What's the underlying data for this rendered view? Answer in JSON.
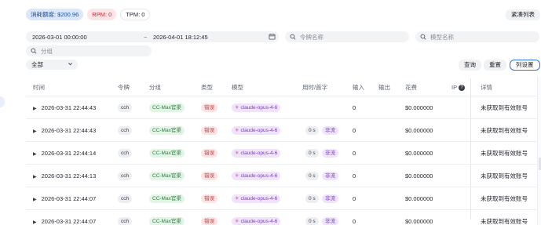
{
  "stats": {
    "quota": "消耗额度: $200.96",
    "rpm": "RPM: 0",
    "tpm": "TPM: 0"
  },
  "toolbar": {
    "compact_label": "紧凑列表",
    "query_label": "查询",
    "reset_label": "重置",
    "columns_label": "列设置"
  },
  "filters": {
    "date_start": "2026-03-01 00:00:00",
    "date_separator": "~",
    "date_end": "2026-04-01 18:12:45",
    "token_placeholder": "令牌名称",
    "model_placeholder": "模型名称",
    "group_placeholder": "分组",
    "type_select": "全部"
  },
  "icons": {
    "search": "search-icon",
    "calendar": "calendar-icon",
    "chevron": "chevron-down-icon",
    "expand": "expand-arrow-icon",
    "help": "help-circle-icon"
  },
  "colors": {
    "accent": "#2f6fe0",
    "quota_bg": "#dbe8fb",
    "rpm_bg": "#fde4e6",
    "group_badge": "#e2f5e7",
    "error_badge": "#fde3e3",
    "model_badge": "#f0e4fb"
  },
  "table": {
    "headers": [
      "时间",
      "令牌",
      "分组",
      "类型",
      "模型",
      "用时/首字",
      "输入",
      "输出",
      "花费",
      "IP",
      "详情"
    ],
    "rows": [
      {
        "time": "2026-03-31 22:44:43",
        "token": "cch",
        "group": "CC-Max官渠",
        "type": "错误",
        "model": "claude-opus-4-6",
        "duration": "",
        "stream": "",
        "input": "0",
        "output": "",
        "cost": "$0.000000",
        "ip": "",
        "detail": "未获取到有效账号"
      },
      {
        "time": "2026-03-31 22:44:43",
        "token": "cch",
        "group": "CC-Max官渠",
        "type": "错误",
        "model": "claude-opus-4-6",
        "duration": "0 s",
        "stream": "非流",
        "input": "0",
        "output": "",
        "cost": "$0.000000",
        "ip": "",
        "detail": "未获取到有效账号"
      },
      {
        "time": "2026-03-31 22:44:14",
        "token": "cch",
        "group": "CC-Max官渠",
        "type": "错误",
        "model": "claude-opus-4-6",
        "duration": "0 s",
        "stream": "非流",
        "input": "0",
        "output": "",
        "cost": "$0.000000",
        "ip": "",
        "detail": "未获取到有效账号"
      },
      {
        "time": "2026-03-31 22:44:13",
        "token": "cch",
        "group": "CC-Max官渠",
        "type": "错误",
        "model": "claude-opus-4-6",
        "duration": "0 s",
        "stream": "非流",
        "input": "0",
        "output": "",
        "cost": "$0.000000",
        "ip": "",
        "detail": "未获取到有效账号"
      },
      {
        "time": "2026-03-31 22:44:07",
        "token": "cch",
        "group": "CC-Max官渠",
        "type": "错误",
        "model": "claude-opus-4-6",
        "duration": "0 s",
        "stream": "非流",
        "input": "0",
        "output": "",
        "cost": "$0.000000",
        "ip": "",
        "detail": "未获取到有效账号"
      },
      {
        "time": "2026-03-31 22:44:07",
        "token": "cch",
        "group": "CC-Max官渠",
        "type": "错误",
        "model": "claude-opus-4-6",
        "duration": "0 s",
        "stream": "非流",
        "input": "0",
        "output": "",
        "cost": "$0.000000",
        "ip": "",
        "detail": "未获取到有效账号"
      }
    ]
  }
}
